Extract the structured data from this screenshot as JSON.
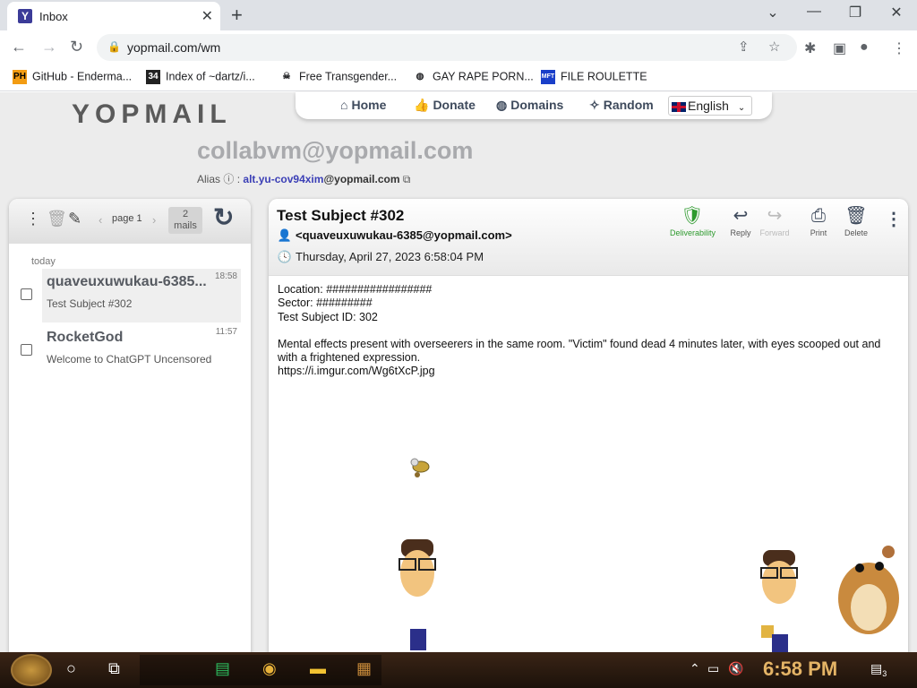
{
  "browser": {
    "tab_title": "Inbox",
    "tab_favicon": "Y",
    "url": "yopmail.com/wm",
    "bookmarks": [
      {
        "label": "GitHub - Enderma...",
        "icon": "PH"
      },
      {
        "label": "Index of ~dartz/i...",
        "icon": "34"
      },
      {
        "label": "Free Transgender...",
        "icon": "skull"
      },
      {
        "label": "GAY RAPE PORN...",
        "icon": "globe"
      },
      {
        "label": "FILE ROULETTE",
        "icon": "MFT"
      }
    ]
  },
  "site": {
    "logo": "YOPMAIL",
    "nav": [
      "Home",
      "Donate",
      "Domains",
      "Random"
    ],
    "language": "English",
    "mailbox": "collabvm@yopmail.com",
    "alias_label": "Alias",
    "alias_link": "alt.yu-cov94xim",
    "alias_domain": "@yopmail.com"
  },
  "inbox": {
    "page_label": "page 1",
    "mail_count": "2",
    "mail_unit": "mails",
    "group": "today",
    "messages": [
      {
        "from": "quaveuxuwukau-6385...",
        "time": "18:58",
        "subject": "Test Subject #302"
      },
      {
        "from": "RocketGod",
        "time": "11:57",
        "subject": "Welcome to ChatGPT Uncensored"
      }
    ]
  },
  "message": {
    "subject": "Test Subject #302",
    "sender": "<quaveuxuwukau-6385@yopmail.com>",
    "date": "Thursday, April 27, 2023 6:58:04 PM",
    "actions": [
      "Deliverability",
      "Reply",
      "Forward",
      "Print",
      "Delete"
    ],
    "body": {
      "location": "Location: #################",
      "sector": "Sector: #########",
      "test_id": "Test Subject ID: 302",
      "paragraph": "Mental effects present with overseerers in the same room. \"Victim\" found dead 4 minutes later, with eyes scooped out and with a frightened expression.",
      "link": "https://i.imgur.com/Wg6tXcP.jpg"
    }
  },
  "taskbar": {
    "clock": "6:58 PM",
    "notifications": "3"
  },
  "colors": {
    "accent": "#3e4a5c",
    "deliverability": "#2e9a2e",
    "alias_link": "#3b3fb6",
    "clock": "#e4b466"
  }
}
